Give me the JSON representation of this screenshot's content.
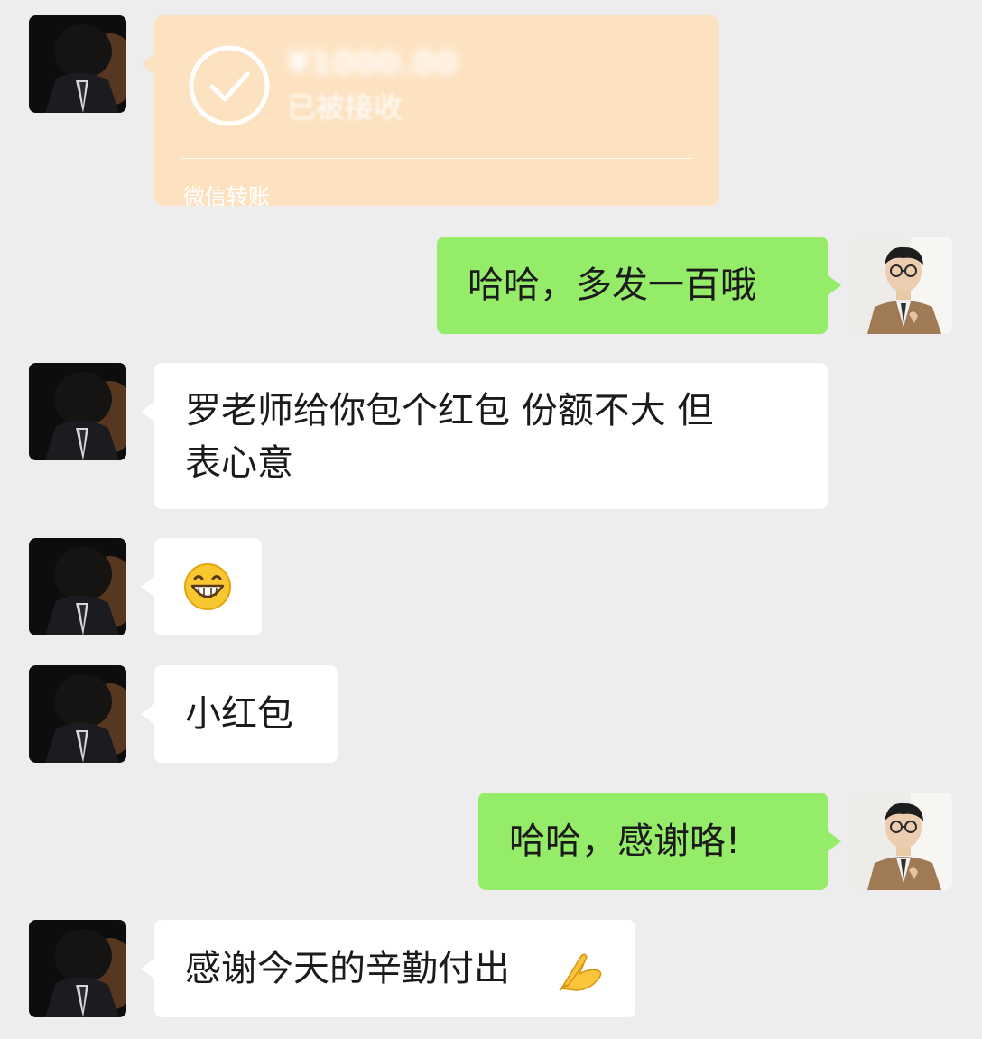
{
  "transfer_card": {
    "amount": "¥1000.00",
    "status": "已被接收",
    "footer": "微信转账"
  },
  "messages": [
    {
      "side": "right",
      "text": "哈哈，多发一百哦"
    },
    {
      "side": "left",
      "text": "罗老师给你包个红包 份额不大 但\n表心意"
    },
    {
      "side": "left",
      "emoji": "grin-emoji"
    },
    {
      "side": "left",
      "text": "小红包"
    },
    {
      "side": "right",
      "text": "哈哈，感谢咯!"
    },
    {
      "side": "left",
      "text": "感谢今天的辛勤付出",
      "emoji": "pray-hands-emoji"
    }
  ],
  "icons": {
    "transfer_received": "check-circle-icon"
  },
  "colors": {
    "background": "#ededed",
    "bubble_self": "#95ec69",
    "bubble_other": "#ffffff",
    "transfer_card": "#fde2c1"
  }
}
